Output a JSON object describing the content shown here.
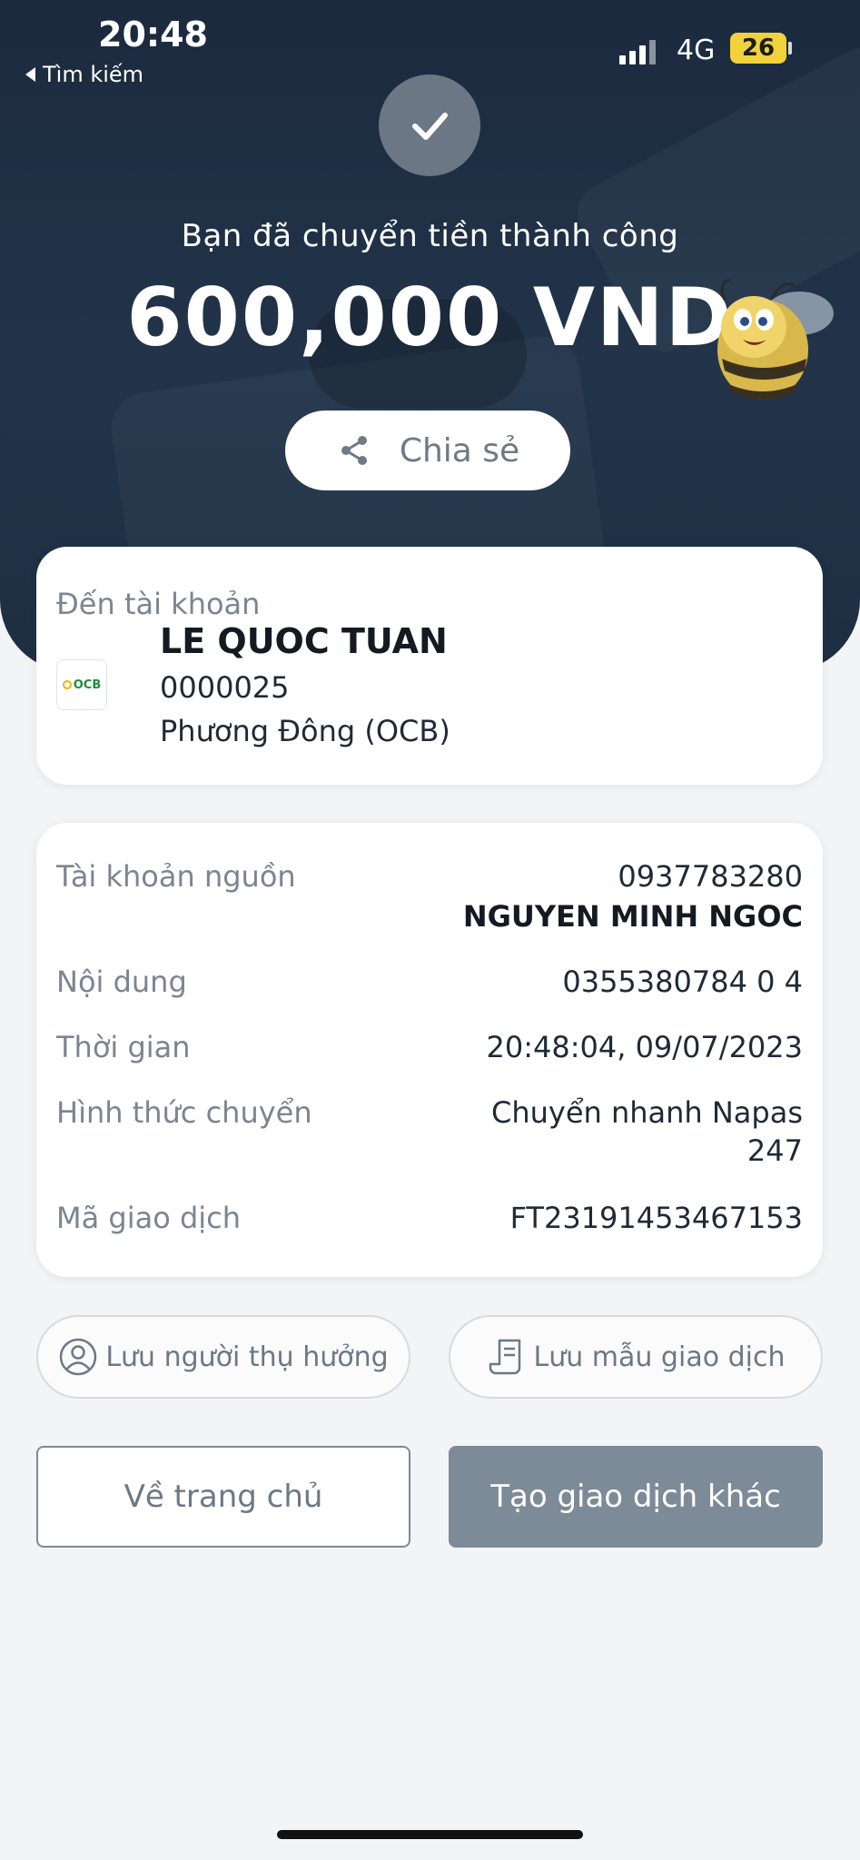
{
  "status_bar": {
    "time": "20:48",
    "back_label": "Tìm kiếm",
    "network": "4G",
    "battery": "26"
  },
  "success": {
    "message": "Bạn đã chuyển tiền thành công",
    "amount": "600,000 VND"
  },
  "share": {
    "label": "Chia sẻ"
  },
  "destination": {
    "title": "Đến tài khoản",
    "bank_logo_text": "OCB",
    "name": "LE QUOC TUAN",
    "account": "0000025",
    "bank": "Phương Đông (OCB)"
  },
  "details": {
    "source_label": "Tài khoản nguồn",
    "source_account": "0937783280",
    "source_name": "NGUYEN MINH NGOC",
    "content_label": "Nội dung",
    "content_value": "0355380784 0 4",
    "time_label": "Thời gian",
    "time_value": "20:48:04, 09/07/2023",
    "method_label": "Hình thức chuyển",
    "method_value_line1": "Chuyển nhanh Napas",
    "method_value_line2": "247",
    "txn_label": "Mã giao dịch",
    "txn_value": "FT23191453467153"
  },
  "actions": {
    "save_beneficiary": "Lưu người thụ hưởng",
    "save_template": "Lưu mẫu giao dịch",
    "home": "Về trang chủ",
    "new_transaction": "Tạo giao dịch khác"
  },
  "icons": {
    "check": "check-icon",
    "share": "share-icon",
    "user": "user-circle-icon",
    "receipt": "receipt-icon"
  },
  "colors": {
    "header_bg": "#1c2a3e",
    "primary_button": "#7d8a97",
    "text_secondary": "#7b8591"
  }
}
